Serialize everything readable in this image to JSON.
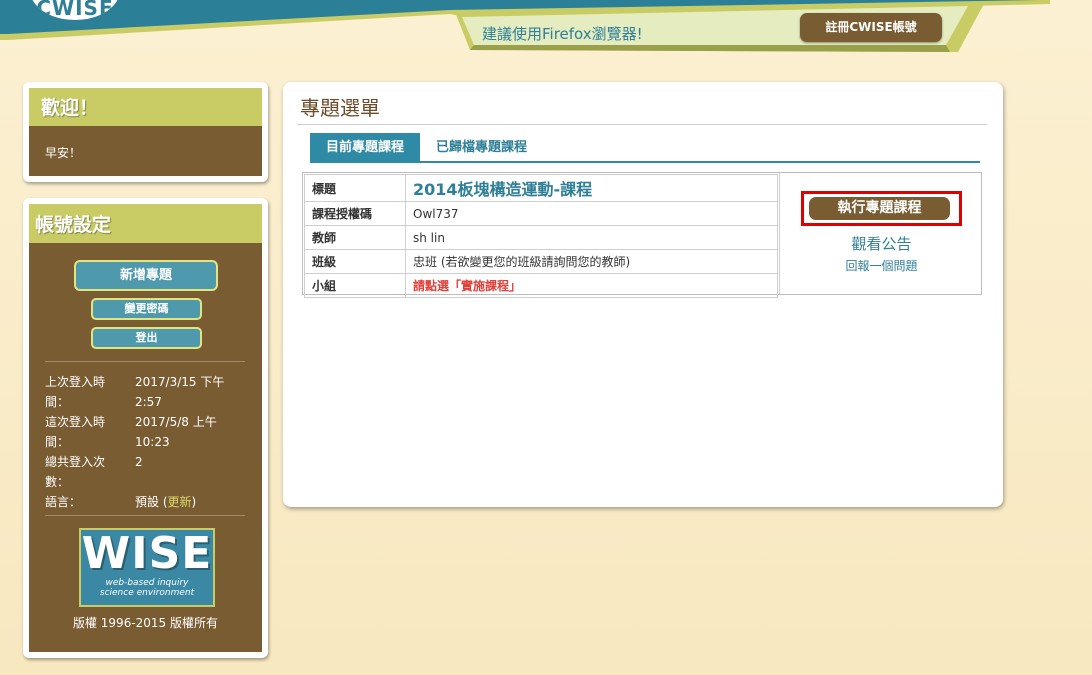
{
  "header": {
    "logo_text": "CWISE",
    "browser_note": "建議使用Firefox瀏覽器!",
    "register_label": "註冊CWISE帳號"
  },
  "welcome": {
    "title": "歡迎！",
    "greeting": "早安！"
  },
  "account": {
    "title": "帳號設定",
    "new_project_label": "新增專題",
    "change_password_label": "變更密碼",
    "logout_label": "登出",
    "last_login_label": "上次登入時間：",
    "last_login_value": "2017/3/15 下午 2:57",
    "this_login_label": "這次登入時間：",
    "this_login_value": "2017/5/8 上午 10:23",
    "total_logins_label": "總共登入次數：",
    "total_logins_value": "2",
    "language_label": "語言：",
    "language_value": "預設",
    "language_update_label": "更新",
    "badge_big": "WISE",
    "badge_small_1": "web-based inquiry",
    "badge_small_2": "science environment",
    "copyright": "版權 1996-2015 版權所有"
  },
  "main": {
    "title": "專題選單",
    "tabs": [
      {
        "label": "目前專題課程"
      },
      {
        "label": "已歸檔專題課程"
      }
    ],
    "project": {
      "rows": [
        {
          "key": "標題",
          "value": "2014板塊構造運動-課程"
        },
        {
          "key": "課程授權碼",
          "value": "Owl737"
        },
        {
          "key": "教師",
          "value": "sh lin"
        },
        {
          "key": "班級",
          "value": "忠班 (若欲變更您的班級請詢問您的教師)"
        },
        {
          "key": "小組",
          "value": "請點選「實施課程」"
        }
      ],
      "run_label": "執行專題課程",
      "announcements_label": "觀看公告",
      "report_problem_label": "回報一個問題"
    }
  },
  "colors": {
    "teal": "#2f7f98",
    "olive": "#c9cc65",
    "brown": "#7a5c33",
    "highlight_red": "#e00000"
  }
}
